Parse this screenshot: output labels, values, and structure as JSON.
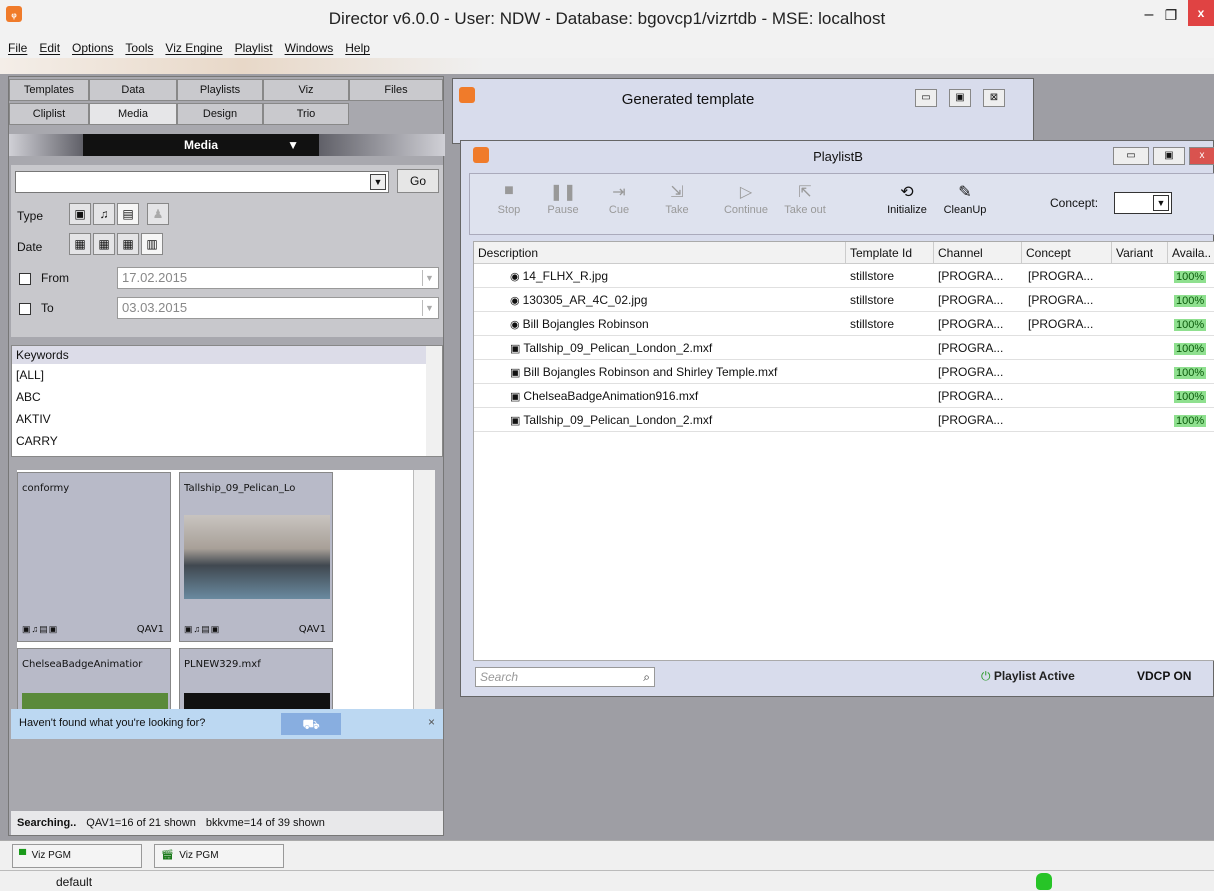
{
  "app": {
    "title": "Director v6.0.0 - User: NDW - Database: bgovcp1/vizrtdb - MSE: localhost",
    "icon": "director-logo-icon",
    "minimize": "–",
    "maximize": "❐",
    "close": "x"
  },
  "menu": [
    "File",
    "Edit",
    "Options",
    "Tools",
    "Viz Engine",
    "Playlist",
    "Windows",
    "Help"
  ],
  "left": {
    "tabs_row1": [
      "Templates",
      "Data",
      "Playlists",
      "Viz",
      "Files"
    ],
    "tabs_row2": [
      "Cliplist",
      "Media",
      "Design",
      "Trio"
    ],
    "active_tab": "Media",
    "panel_title": "Media",
    "search": {
      "value": "",
      "go": "Go"
    },
    "type_label": "Type",
    "date_label": "Date",
    "from_label": "From",
    "from_value": "17.02.2015",
    "to_label": "To",
    "to_value": "03.03.2015",
    "keywords": {
      "header": "Keywords",
      "items": [
        "[ALL]",
        "ABC",
        "AKTIV",
        "CARRY"
      ]
    },
    "thumbnails": [
      {
        "title": "conformy",
        "tag": "QAV1"
      },
      {
        "title": "Tallship_09_Pelican_Lo",
        "tag": "QAV1"
      },
      {
        "title": "ChelseaBadgeAnimatior",
        "tag": ""
      },
      {
        "title": "PLNEW329.mxf",
        "tag": ""
      }
    ],
    "hint": "Haven't found what you're looking for?",
    "hint_close": "×",
    "status": {
      "searching": "Searching..",
      "qav": "QAV1=16 of 21 shown",
      "bkk": "bkkvme=14 of 39 shown"
    }
  },
  "generated_template": {
    "title": "Generated template"
  },
  "playlist": {
    "title": "PlaylistB",
    "tools": [
      {
        "label": "Stop",
        "icon": "■",
        "enabled": false
      },
      {
        "label": "Pause",
        "icon": "❚❚",
        "enabled": false
      },
      {
        "label": "Cue",
        "icon": "⇥",
        "enabled": false
      },
      {
        "label": "Take",
        "icon": "⇲",
        "enabled": false
      },
      {
        "label": "Continue",
        "icon": "▷",
        "enabled": false
      },
      {
        "label": "Take out",
        "icon": "⇱",
        "enabled": false
      },
      {
        "label": "Initialize",
        "icon": "⟲",
        "enabled": true
      },
      {
        "label": "CleanUp",
        "icon": "✎",
        "enabled": true
      }
    ],
    "concept_label": "Concept:",
    "columns": [
      "Description",
      "Template Id",
      "Channel",
      "Concept",
      "Variant",
      "Availa.."
    ],
    "rows": [
      {
        "icon": "camera-icon",
        "glyph": "◉",
        "description": "14_FLHX_R.jpg",
        "template": "stillstore",
        "channel": "[PROGRA...",
        "concept": "[PROGRA...",
        "variant": "",
        "avail": "100%"
      },
      {
        "icon": "camera-icon",
        "glyph": "◉",
        "description": "130305_AR_4C_02.jpg",
        "template": "stillstore",
        "channel": "[PROGRA...",
        "concept": "[PROGRA...",
        "variant": "",
        "avail": "100%"
      },
      {
        "icon": "camera-icon",
        "glyph": "◉",
        "description": "Bill Bojangles Robinson",
        "template": "stillstore",
        "channel": "[PROGRA...",
        "concept": "[PROGRA...",
        "variant": "",
        "avail": "100%"
      },
      {
        "icon": "video-icon",
        "glyph": "▣",
        "description": "Tallship_09_Pelican_London_2.mxf",
        "template": "",
        "channel": "[PROGRA...",
        "concept": "",
        "variant": "",
        "avail": "100%"
      },
      {
        "icon": "video-icon",
        "glyph": "▣",
        "description": "Bill Bojangles Robinson and Shirley Temple.mxf",
        "template": "",
        "channel": "[PROGRA...",
        "concept": "",
        "variant": "",
        "avail": "100%"
      },
      {
        "icon": "video-icon",
        "glyph": "▣",
        "description": "ChelseaBadgeAnimation916.mxf",
        "template": "",
        "channel": "[PROGRA...",
        "concept": "",
        "variant": "",
        "avail": "100%"
      },
      {
        "icon": "video-icon",
        "glyph": "▣",
        "description": "Tallship_09_Pelican_London_2.mxf",
        "template": "",
        "channel": "[PROGRA...",
        "concept": "",
        "variant": "",
        "avail": "100%"
      }
    ],
    "search_placeholder": "Search",
    "status_text": "Playlist Active",
    "vdcp": "VDCP ON"
  },
  "outputs": [
    {
      "label": "Viz PGM",
      "icon": "monitor-icon"
    },
    {
      "label": "Viz PGM",
      "icon": "clapper-icon"
    }
  ],
  "statusbar": {
    "profile": "default"
  }
}
